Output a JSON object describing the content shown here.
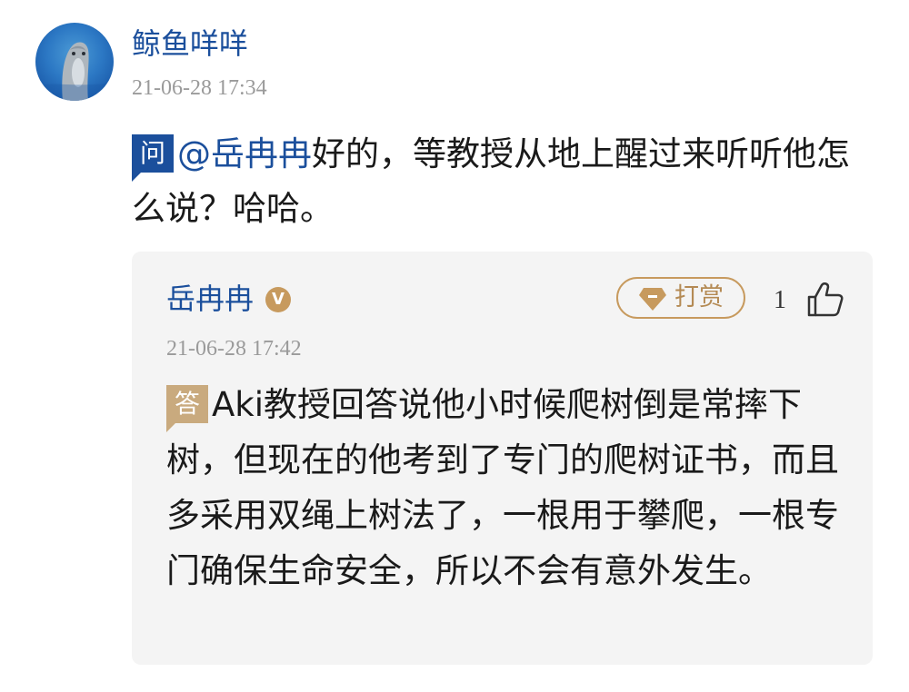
{
  "comment": {
    "author": "鲸鱼咩咩",
    "timestamp": "21-06-28 17:34",
    "question_badge": "问",
    "mention": "@岳冉冉",
    "text": "好的，等教授从地上醒过来听听他怎么说？哈哈。",
    "avatar_icon": "dolphin-avatar"
  },
  "reply": {
    "author": "岳冉冉",
    "verified_badge": "V",
    "tip_button_label": "打赏",
    "tip_icon": "diamond-tag-icon",
    "like_count": "1",
    "like_icon": "thumbs-up-icon",
    "timestamp": "21-06-28 17:42",
    "answer_badge": "答",
    "text": "Aki教授回答说他小时候爬树倒是常摔下树，但现在的他考到了专门的爬树证书，而且多采用双绳上树法了，一根用于攀爬，一根专门确保生命安全，所以不会有意外发生。"
  },
  "colors": {
    "link_blue": "#1b4f9c",
    "gold": "#c79a5e",
    "answer_badge": "#c9aa7e",
    "reply_bg": "#f4f4f4",
    "meta_gray": "#9a9a9a"
  }
}
